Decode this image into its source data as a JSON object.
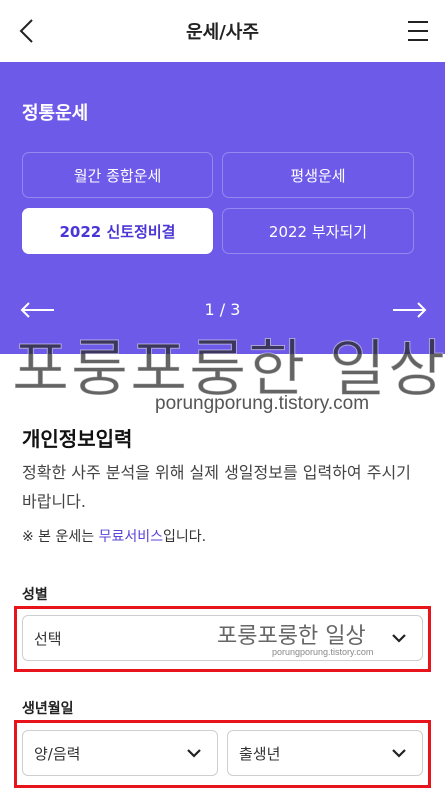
{
  "header": {
    "title": "운세/사주",
    "back_icon": "chevron-left-icon",
    "menu_icon": "hamburger-menu-icon"
  },
  "hero": {
    "section_title": "정통운세",
    "chips": [
      {
        "label": "월간 종합운세",
        "active": false
      },
      {
        "label": "평생운세",
        "active": false
      },
      {
        "label": "2022 신토정비결",
        "active": true
      },
      {
        "label": "2022 부자되기",
        "active": false
      }
    ],
    "pager": "1 / 3",
    "prev_icon": "arrow-left-icon",
    "next_icon": "arrow-right-icon",
    "background_color": "#6d5ae8"
  },
  "watermark": {
    "text": "포룽포룽한 일상",
    "url": "porungporung.tistory.com"
  },
  "info": {
    "title": "개인정보입력",
    "description": "정확한 사주 분석을 위해 실제 생일정보를 입력하여 주시기 바랍니다.",
    "note_prefix": "※ 본 운세는 ",
    "note_link": "무료서비스",
    "note_suffix": "입니다."
  },
  "form": {
    "gender_label": "성별",
    "gender_value": "선택",
    "birth_label": "생년월일",
    "calendar_value": "양/음력",
    "year_value": "출생년"
  },
  "colors": {
    "accent": "#6d5ae8",
    "highlight_box": "#e8141c",
    "link": "#5a44d8"
  }
}
